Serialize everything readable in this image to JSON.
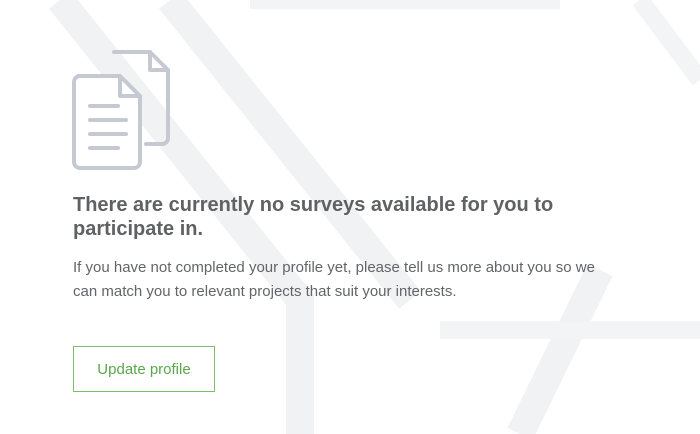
{
  "empty_state": {
    "icon": "documents-icon",
    "title": "There are currently no surveys available for you to participate in.",
    "description": "If you have not completed your profile yet, please tell us more about you so we can match you to relevant projects that suit your interests.",
    "button_label": "Update profile"
  },
  "colors": {
    "title": "#5f6164",
    "text": "#626569",
    "icon": "#c5cad2",
    "button_border": "#7fbd6a",
    "button_text": "#5aa74a",
    "background_pattern": "#eef0f2"
  }
}
